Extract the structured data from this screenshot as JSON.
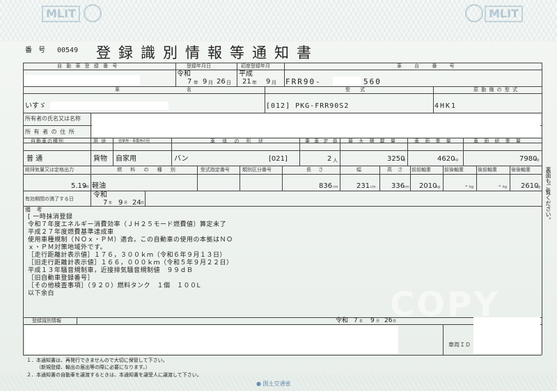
{
  "watermarks": {
    "mlit_left": "MLIT",
    "mlit_right": "MLIT",
    "copy": "COPY"
  },
  "header": {
    "number_label": "番 号",
    "number_value": "00549",
    "title": "登録識別情報等通知書"
  },
  "row1": {
    "reg_no_label": "自 動 車 登 録 番 号",
    "reg_date_label": "登録年月日",
    "first_reg_label": "初度登録年月",
    "chassis_label": "車 台 番 号",
    "era_reiwa": "令和",
    "reg_year": "7",
    "reg_month": "9",
    "reg_day": "26",
    "era_heisei": "平成",
    "first_year": "21",
    "first_month": "9",
    "chassis_prefix": "FRR90-",
    "chassis_suffix": "560",
    "unit_year": "年",
    "unit_month": "月",
    "unit_day": "日"
  },
  "row2": {
    "make_label": "車",
    "name_label": "名",
    "model_label": "型 式",
    "engine_label": "原 動 機 の 型 式",
    "make_value": "いすゞ",
    "model_value": "[012] PKG-FRR90S2",
    "engine_value": "4HK1"
  },
  "owner": {
    "name_label": "所有者の氏名又は名称",
    "address_label": "所 有 者 の 住 所"
  },
  "row3": {
    "kind_label": "自動車の種別",
    "use_label": "用 途",
    "use_sub_label": "自家用・事業用の別",
    "body_label": "車 体 の 形 状",
    "capacity_label": "乗 車 定 員",
    "max_load_label": "最 大 積 載 量",
    "weight_label": "車 両 重 量",
    "gross_label": "車 両 総 重 量",
    "kind_value": "普 通",
    "use_value": "貨物",
    "private_value": "自家用",
    "body_value": "バン",
    "body_code": "[021]",
    "capacity_value": "2",
    "capacity_unit": "人",
    "max_load_value": "3250",
    "weight_value": "4620",
    "gross_value": "7980",
    "kg_unit": "kg"
  },
  "row4": {
    "displacement_label": "総排気量又は定格出力",
    "fuel_label": "燃 料 の 種 別",
    "type_approval_label": "型式指定番号",
    "category_label": "類別区分番号",
    "length_label": "長 さ",
    "width_label": "幅",
    "height_label": "高 さ",
    "front_front_label": "前前軸重",
    "front_rear_label": "前後軸重",
    "rear_front_label": "後前軸重",
    "rear_rear_label": "後後軸重",
    "displacement_value": "5.19",
    "displacement_unit": "kW",
    "fuel_value": "軽油",
    "length_value": "836",
    "width_value": "231",
    "height_value": "336",
    "cm_unit": "cm",
    "front_front_value": "2010",
    "front_rear_value": "-",
    "rear_front_value": "-",
    "rear_rear_value": "2610",
    "side_note": "裏面もご覧ください。"
  },
  "expiry": {
    "label": "有効期間の満了する日",
    "era": "令和",
    "year": "7",
    "month": "9",
    "day": "24"
  },
  "remarks": {
    "label": "備 考",
    "lines": [
      "[ 一時抹消登録",
      "令和７年度エネルギー消費効率（ＪＨ２５モード燃費値）算定未了",
      "平成２７年度燃費基準達成車",
      "使用車種規制（ＮＯｘ・ＰＭ）適合。この自動車の使用の本拠はＮＯ",
      "ｘ・ＰＭ対策地域外です。",
      "［走行距離計表示値］１７６，３００ｋｍ（令和６年９月１３日）",
      "［旧走行距離計表示値］１６６，０００ｋｍ（令和５年９月２２日）",
      "平成１３年騒音規制車，近接排気騒音規制値　９９ｄＢ",
      "［旧自動車登録番号］",
      "［その他検査事項］（９２０）燃料タンク　１個　１００L",
      "以下余白"
    ]
  },
  "footer": {
    "info_label": "登録識別情報",
    "issue_era": "令和",
    "issue_year": "7",
    "issue_month": "9",
    "issue_day": "26",
    "vehicle_id_label": "車両ＩＤ",
    "notes": [
      "１．本通知書は、再発行できませんので大切に保管して下さい。",
      "（新規登録、輸出の届出等の際に必要になります。）",
      "２．本通知書の自動車を譲渡するときは、本通知書を譲受人に譲渡して下さい。"
    ],
    "ministry": "国土交通省"
  }
}
